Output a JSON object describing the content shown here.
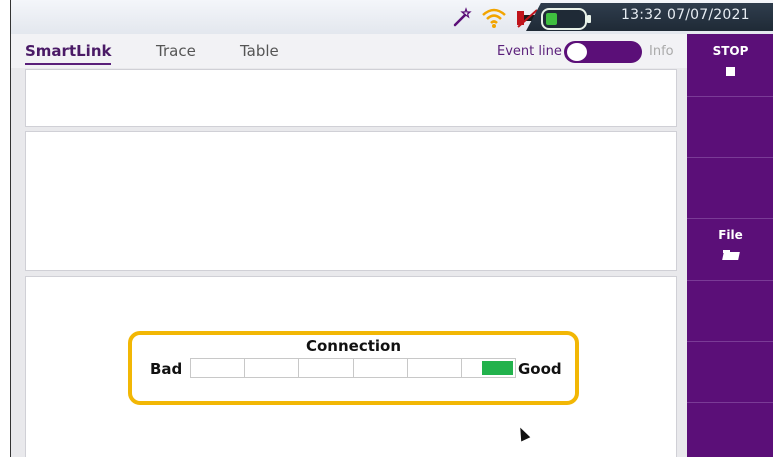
{
  "status_bar": {
    "icons": [
      "wand-icon",
      "wifi-icon",
      "dc-power-icon",
      "battery-icon"
    ],
    "time": "13:32",
    "date": "07/07/2021"
  },
  "tabs": [
    {
      "label": "SmartLink",
      "active": true
    },
    {
      "label": "Trace",
      "active": false
    },
    {
      "label": "Table",
      "active": false
    }
  ],
  "event_line": {
    "label": "Event line",
    "state": "on",
    "info_label": "Info"
  },
  "sidebar": {
    "stop_label": "STOP",
    "file_label": "File"
  },
  "connection": {
    "title": "Connection",
    "low_label": "Bad",
    "high_label": "Good",
    "segments": 6,
    "level": 1,
    "level_color": "#22b24c"
  },
  "colors": {
    "accent": "#5b0f78",
    "highlight": "#f2b705"
  }
}
